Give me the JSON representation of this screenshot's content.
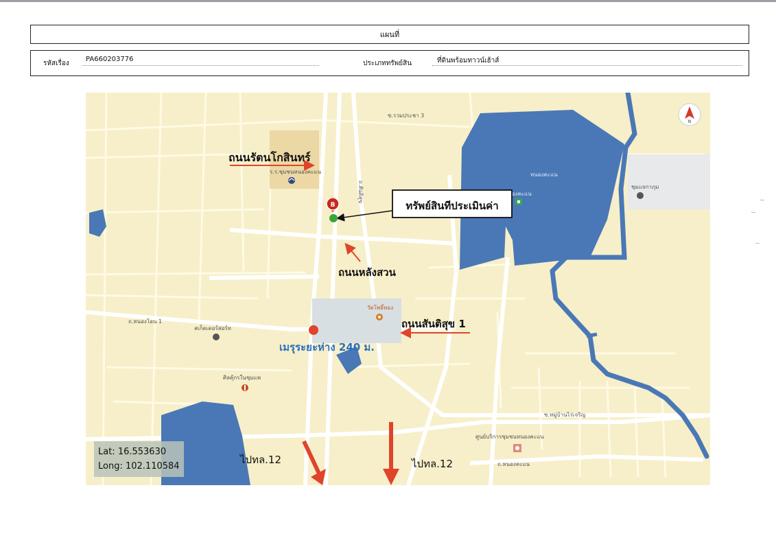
{
  "header": {
    "title": "แผนที่"
  },
  "info": {
    "case_label": "รหัสเรื่อง",
    "case_value": "PA660203776",
    "type_label": "ประเภททรัพย์สิน",
    "type_value": "ที่ดินพร้อมทาวน์เฮ้าส์"
  },
  "map": {
    "callout": "ทรัพย์สินทีประเมินค่า",
    "roads": {
      "rattanakosin": "ถนนรัตนโกสินทร์",
      "lang_suan": "ถนนหลังสวน",
      "santisuk": "ถนนสันติสุข 1",
      "to_road_left": "ไปทล.12",
      "to_road_right": "ไปทล.12"
    },
    "distance_label": "เมรุระยะห่าง 240 ม.",
    "small_labels": {
      "road_top": "ซ.รวมประชา 3",
      "school_top": "ร.ร.ชุมชนหนองคะแน",
      "road_vertical": "ถ.สันติสุข",
      "lake": "หนองคะแน",
      "poi_right": "ชุมแจกาภุม",
      "poi_market": "หนองคะแน",
      "road_left": "ถ.หนองโอน 1",
      "poi_left": "สเก็ตเตอร์สอร์ท",
      "temple": "วัดโพธิ์ทอง",
      "church": "ศิลคุ้กรในชุมแพ",
      "road_bottom_right": "ซ.หมู่บ้านไร่เจริญ",
      "health_center": "ศูนย์บริการชุมชนหนองคะแน",
      "road_bottom": "ถ.หนองคะแน"
    },
    "marker_letter": "B",
    "compass": "N",
    "lat": "Lat: 16.553630",
    "long": "Long: 102.110584"
  },
  "colors": {
    "map_bg": "#f6efc9",
    "road": "#ffffff",
    "water": "#4a78b6",
    "arrow": "#e0442a",
    "marker_red": "#c8291e",
    "marker_green": "#3aa53a"
  }
}
